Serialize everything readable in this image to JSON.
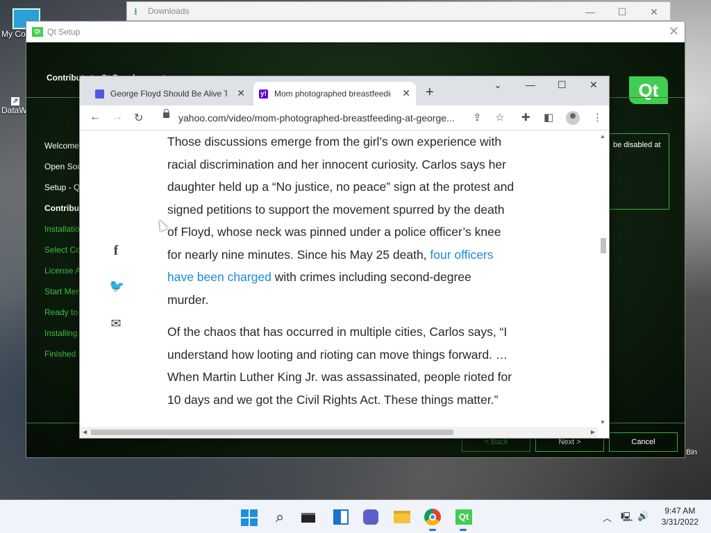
{
  "desktop": {
    "icon1_label": "My Co",
    "icon2_label": "DataW",
    "recycle_label": "Bin"
  },
  "downloads": {
    "title": "Downloads"
  },
  "qt_setup": {
    "window_title": "Qt Setup",
    "badge": "Qt",
    "heading": "Contribute to Qt Development",
    "logo": "Qt",
    "steps": [
      "Welcome",
      "Open Sou",
      "Setup - Q",
      "Contribut",
      "Installatio",
      "Select Co",
      "License A",
      "Start Men",
      "Ready to I",
      "Installing",
      "Finished"
    ],
    "info_text": "be disabled at",
    "back_label": "< Back",
    "next_label": "Next >",
    "cancel_label": "Cancel"
  },
  "chrome": {
    "tabs": [
      {
        "title": "George Floyd Should Be Alive Tod"
      },
      {
        "title": "Mom photographed breastfeedin"
      }
    ],
    "url": "yahoo.com/video/mom-photographed-breastfeeding-at-george...",
    "article": {
      "p1_a": "Those discussions emerge from the girl’s own experience with racial discrimination and her innocent curiosity. Carlos says her daughter held up a “No justice, no peace” sign at the protest and signed petitions to support the movement spurred by the death of Floyd, whose neck was pinned under a police officer’s knee for nearly nine minutes. Since his May 25 death, ",
      "p1_link": "four officers have been charged",
      "p1_b": " with crimes including second-degree murder.",
      "p2": "Of the chaos that has occurred in multiple cities, Carlos says, “I understand how looting and rioting can move things forward. … When Martin Luther King Jr. was assassinated, people rioted for 10 days and we got the Civil Rights Act. These things matter.”"
    }
  },
  "taskbar": {
    "time": "9:47 AM",
    "date": "3/31/2022",
    "qt_label": "Qt"
  },
  "colors": {
    "qt_green": "#41cd52",
    "link_blue": "#1a8ad8",
    "yahoo_purple": "#6001d2"
  }
}
